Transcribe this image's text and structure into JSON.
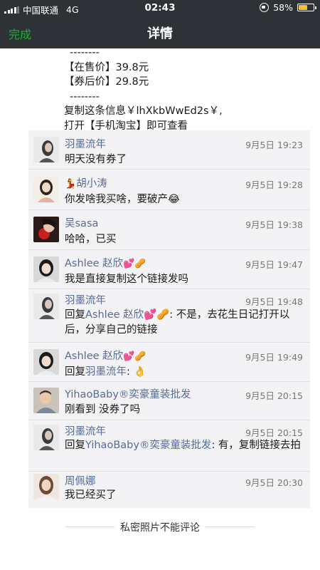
{
  "status_bar": {
    "carrier": "中国联通",
    "network": "4G",
    "time": "02:43",
    "battery_percent": "58%",
    "battery_level": 0.58,
    "battery_color": "#f2c230"
  },
  "nav": {
    "back_label": "完成",
    "title": "详情"
  },
  "post": {
    "lines": [
      "--------",
      "【在售价】39.8元",
      "【券后价】29.8元",
      "--------",
      "复制这条信息￥lhXkbWwEd2s￥,",
      "打开【手机淘宝】即可查看"
    ]
  },
  "comments": [
    {
      "name": "羽墨流年",
      "time": "9月5日 19:23",
      "text": "明天没有券了"
    },
    {
      "name": "胡小涛",
      "name_emoji": "💃",
      "time": "9月5日 19:28",
      "text": "你发啥我买啥，要破产😂"
    },
    {
      "name": "吴sasa",
      "time": "9月5日 19:38",
      "text": "哈哈，已买"
    },
    {
      "name": "Ashlee 赵欣",
      "name_emoji_after": "💕🥜",
      "time": "9月5日 19:47",
      "text": "我是直接复制这个链接发吗"
    },
    {
      "name": "羽墨流年",
      "time": "9月5日 19:48",
      "reply_prefix": "回复",
      "reply_to": "Ashlee 赵欣💕🥜",
      "text": ": 不是，去花生日记打开以后，分享自己的链接"
    },
    {
      "name": "Ashlee 赵欣",
      "name_emoji_after": "💕🥜",
      "time": "9月5日 19:49",
      "reply_prefix": "回复",
      "reply_to": "羽墨流年",
      "text": ": 👌"
    },
    {
      "name": "YihaoBaby®奕豪童装批发",
      "time": "9月5日 20:15",
      "text": "刚看到 没券了吗"
    },
    {
      "name": "羽墨流年",
      "time": "9月5日 20:15",
      "reply_prefix": "回复",
      "reply_to": "YihaoBaby®奕豪童装批发",
      "text": ": 有，复制链接去拍"
    },
    {
      "name": "周佩娜",
      "time": "9月5日 20:30",
      "text": "我已经买了"
    }
  ],
  "footer": {
    "note": "私密照片不能评论"
  },
  "colors": {
    "bar_bg": "#2e3135",
    "link": "#576b95",
    "accent_green": "#1ead36",
    "comment_bg": "#f3f3f5"
  }
}
